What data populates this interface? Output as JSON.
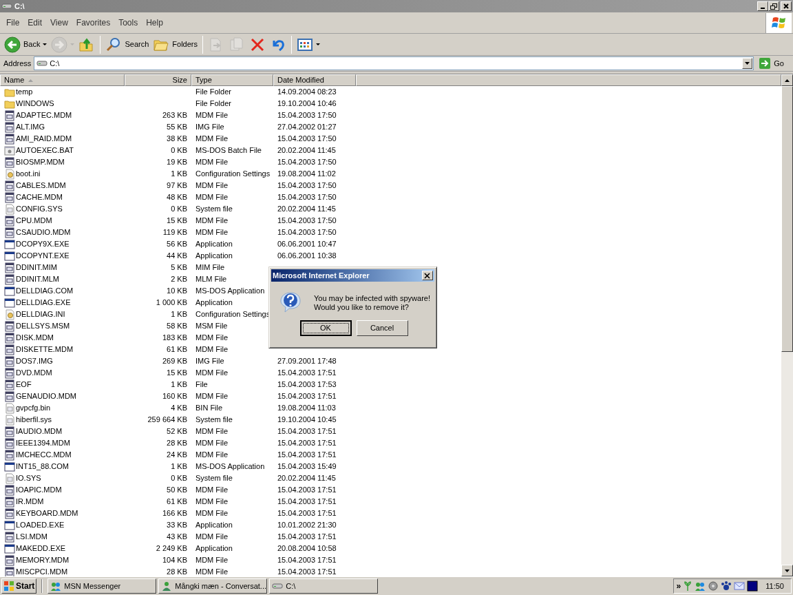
{
  "window": {
    "title": "C:\\"
  },
  "menu": [
    {
      "label": "File"
    },
    {
      "label": "Edit"
    },
    {
      "label": "View"
    },
    {
      "label": "Favorites"
    },
    {
      "label": "Tools"
    },
    {
      "label": "Help"
    }
  ],
  "toolbar": [
    {
      "kind": "back",
      "label": "Back",
      "disabled": false
    },
    {
      "kind": "forward",
      "disabled": true
    },
    {
      "kind": "up",
      "disabled": false
    },
    {
      "kind": "search",
      "label": "Search",
      "disabled": false
    },
    {
      "kind": "folders",
      "label": "Folders",
      "disabled": false
    },
    {
      "kind": "move",
      "disabled": true
    },
    {
      "kind": "copy",
      "disabled": true
    },
    {
      "kind": "delete",
      "disabled": false
    },
    {
      "kind": "undo",
      "disabled": false
    },
    {
      "kind": "views",
      "disabled": false
    }
  ],
  "address": {
    "label": "Address",
    "value": "C:\\",
    "go": "Go"
  },
  "list": {
    "columns": [
      {
        "label": "Name",
        "sorted": true
      },
      {
        "label": "Size",
        "sorted": false
      },
      {
        "label": "Type",
        "sorted": false
      },
      {
        "label": "Date Modified",
        "sorted": false
      }
    ],
    "rows": [
      {
        "kind": "folder",
        "name": "temp",
        "type": "File Folder",
        "date": "14.09.2004 08:23"
      },
      {
        "kind": "folder",
        "name": "WINDOWS",
        "type": "File Folder",
        "date": "19.10.2004 10:46"
      },
      {
        "kind": "file",
        "name": "ADAPTEC.MDM",
        "size": "263 KB",
        "type": "MDM File",
        "date": "15.04.2003 17:50"
      },
      {
        "kind": "file",
        "name": "ALT.IMG",
        "size": "55 KB",
        "type": "IMG File",
        "date": "27.04.2002 01:27"
      },
      {
        "kind": "file",
        "name": "AMI_RAID.MDM",
        "size": "38 KB",
        "type": "MDM File",
        "date": "15.04.2003 17:50"
      },
      {
        "kind": "batch",
        "name": "AUTOEXEC.BAT",
        "size": "0 KB",
        "type": "MS-DOS Batch File",
        "date": "20.02.2004 11:45"
      },
      {
        "kind": "file",
        "name": "BIOSMP.MDM",
        "size": "19 KB",
        "type": "MDM File",
        "date": "15.04.2003 17:50"
      },
      {
        "kind": "settings",
        "name": "boot.ini",
        "size": "1 KB",
        "type": "Configuration Settings",
        "date": "19.08.2004 11:02"
      },
      {
        "kind": "file",
        "name": "CABLES.MDM",
        "size": "97 KB",
        "type": "MDM File",
        "date": "15.04.2003 17:50"
      },
      {
        "kind": "file",
        "name": "CACHE.MDM",
        "size": "48 KB",
        "type": "MDM File",
        "date": "15.04.2003 17:50"
      },
      {
        "kind": "system",
        "name": "CONFIG.SYS",
        "size": "0 KB",
        "type": "System file",
        "date": "20.02.2004 11:45"
      },
      {
        "kind": "file",
        "name": "CPU.MDM",
        "size": "15 KB",
        "type": "MDM File",
        "date": "15.04.2003 17:50"
      },
      {
        "kind": "file",
        "name": "CSAUDIO.MDM",
        "size": "119 KB",
        "type": "MDM File",
        "date": "15.04.2003 17:50"
      },
      {
        "kind": "application",
        "name": "DCOPY9X.EXE",
        "size": "56 KB",
        "type": "Application",
        "date": "06.06.2001 10:47"
      },
      {
        "kind": "application",
        "name": "DCOPYNT.EXE",
        "size": "44 KB",
        "type": "Application",
        "date": "06.06.2001 10:38"
      },
      {
        "kind": "file",
        "name": "DDINIT.MIM",
        "size": "5 KB",
        "type": "MIM File"
      },
      {
        "kind": "file",
        "name": "DDINIT.MLM",
        "size": "2 KB",
        "type": "MLM File"
      },
      {
        "kind": "application",
        "name": "DELLDIAG.COM",
        "size": "10 KB",
        "type": "MS-DOS Application"
      },
      {
        "kind": "application",
        "name": "DELLDIAG.EXE",
        "size": "1 000 KB",
        "type": "Application"
      },
      {
        "kind": "settings",
        "name": "DELLDIAG.INI",
        "size": "1 KB",
        "type": "Configuration Settings"
      },
      {
        "kind": "file",
        "name": "DELLSYS.MSM",
        "size": "58 KB",
        "type": "MSM File"
      },
      {
        "kind": "file",
        "name": "DISK.MDM",
        "size": "183 KB",
        "type": "MDM File"
      },
      {
        "kind": "file",
        "name": "DISKETTE.MDM",
        "size": "61 KB",
        "type": "MDM File"
      },
      {
        "kind": "file",
        "name": "DOS7.IMG",
        "size": "269 KB",
        "type": "IMG File",
        "date": "27.09.2001 17:48"
      },
      {
        "kind": "file",
        "name": "DVD.MDM",
        "size": "15 KB",
        "type": "MDM File",
        "date": "15.04.2003 17:51"
      },
      {
        "kind": "file",
        "name": "EOF",
        "size": "1 KB",
        "type": "File",
        "date": "15.04.2003 17:53"
      },
      {
        "kind": "file",
        "name": "GENAUDIO.MDM",
        "size": "160 KB",
        "type": "MDM File",
        "date": "15.04.2003 17:51"
      },
      {
        "kind": "system",
        "name": "gvpcfg.bin",
        "size": "4 KB",
        "type": "BIN File",
        "date": "19.08.2004 11:03"
      },
      {
        "kind": "system",
        "name": "hiberfil.sys",
        "size": "259 664 KB",
        "type": "System file",
        "date": "19.10.2004 10:45"
      },
      {
        "kind": "file",
        "name": "IAUDIO.MDM",
        "size": "52 KB",
        "type": "MDM File",
        "date": "15.04.2003 17:51"
      },
      {
        "kind": "file",
        "name": "IEEE1394.MDM",
        "size": "28 KB",
        "type": "MDM File",
        "date": "15.04.2003 17:51"
      },
      {
        "kind": "file",
        "name": "IMCHECC.MDM",
        "size": "24 KB",
        "type": "MDM File",
        "date": "15.04.2003 17:51"
      },
      {
        "kind": "application",
        "name": "INT15_88.COM",
        "size": "1 KB",
        "type": "MS-DOS Application",
        "date": "15.04.2003 15:49"
      },
      {
        "kind": "system",
        "name": "IO.SYS",
        "size": "0 KB",
        "type": "System file",
        "date": "20.02.2004 11:45"
      },
      {
        "kind": "file",
        "name": "IOAPIC.MDM",
        "size": "50 KB",
        "type": "MDM File",
        "date": "15.04.2003 17:51"
      },
      {
        "kind": "file",
        "name": "IR.MDM",
        "size": "61 KB",
        "type": "MDM File",
        "date": "15.04.2003 17:51"
      },
      {
        "kind": "file",
        "name": "KEYBOARD.MDM",
        "size": "166 KB",
        "type": "MDM File",
        "date": "15.04.2003 17:51"
      },
      {
        "kind": "application",
        "name": "LOADED.EXE",
        "size": "33 KB",
        "type": "Application",
        "date": "10.01.2002 21:30"
      },
      {
        "kind": "file",
        "name": "LSI.MDM",
        "size": "43 KB",
        "type": "MDM File",
        "date": "15.04.2003 17:51"
      },
      {
        "kind": "application",
        "name": "MAKEDD.EXE",
        "size": "2 249 KB",
        "type": "Application",
        "date": "20.08.2004 10:58"
      },
      {
        "kind": "file",
        "name": "MEMORY.MDM",
        "size": "104 KB",
        "type": "MDM File",
        "date": "15.04.2003 17:51"
      },
      {
        "kind": "file",
        "name": "MISCPCI.MDM",
        "size": "28 KB",
        "type": "MDM File",
        "date": "15.04.2003 17:51"
      }
    ]
  },
  "dialog": {
    "title": "Microsoft Internet Explorer",
    "message": [
      "You may be infected with spyware!",
      "Would you like to remove it?"
    ],
    "buttons": [
      {
        "label": "OK",
        "focused": true
      },
      {
        "label": "Cancel",
        "focused": false
      }
    ]
  },
  "taskbar": {
    "start": "Start",
    "tasks": [
      {
        "kind": "messenger",
        "label": "MSN Messenger"
      },
      {
        "kind": "conversation",
        "label": "Mångki mæn - Conversat..."
      },
      {
        "kind": "drive",
        "label": "C:\\"
      }
    ],
    "tray_expand": "»",
    "clock": "11:50"
  }
}
